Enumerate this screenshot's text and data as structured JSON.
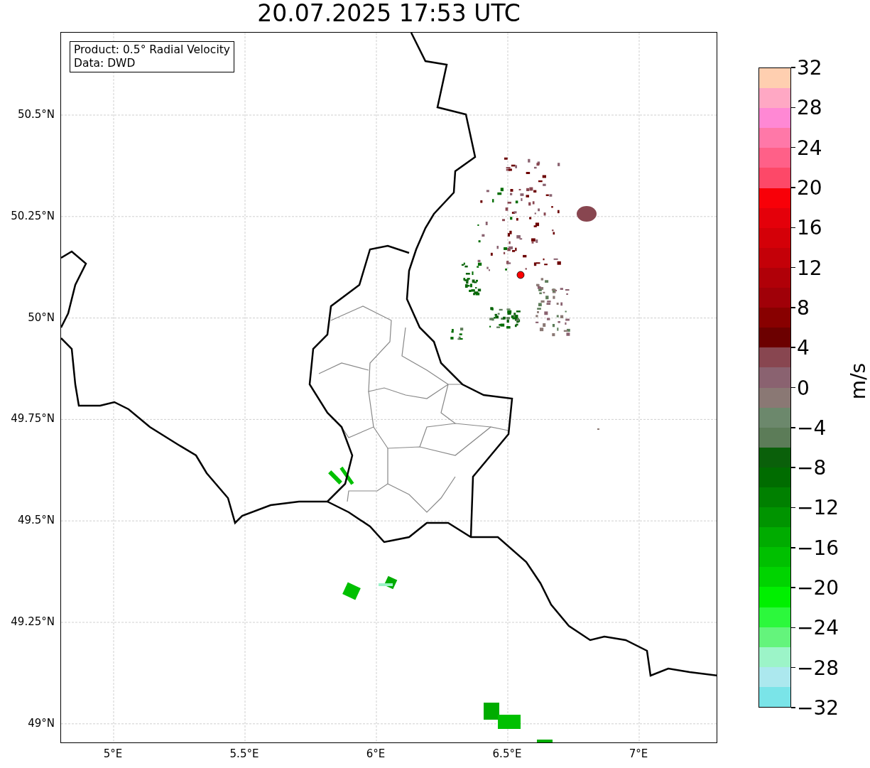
{
  "title": "20.07.2025 17:53 UTC",
  "info_box": {
    "lines": [
      "Product: 0.5° Radial Velocity",
      "Data: DWD"
    ]
  },
  "map": {
    "xticks": [
      "5°E",
      "5.5°E",
      "6°E",
      "6.5°E",
      "7°E"
    ],
    "yticks": [
      "50.5°N",
      "50.25°N",
      "50°N",
      "49.75°N",
      "49.5°N",
      "49.25°N",
      "49°N"
    ]
  },
  "colorbar": {
    "label": "m/s",
    "ticks": [
      "32",
      "28",
      "24",
      "20",
      "16",
      "12",
      "8",
      "4",
      "0",
      "−4",
      "−8",
      "−12",
      "−16",
      "−20",
      "−24",
      "−28",
      "−32"
    ],
    "bands": [
      {
        "color": "#ffcfb0"
      },
      {
        "color": "#ffa8c4"
      },
      {
        "color": "#ff88d4"
      },
      {
        "color": "#ff78a8"
      },
      {
        "color": "#ff6088"
      },
      {
        "color": "#fd4868"
      },
      {
        "color": "#f80008"
      },
      {
        "color": "#e4000a"
      },
      {
        "color": "#d40008"
      },
      {
        "color": "#c40008"
      },
      {
        "color": "#b00008"
      },
      {
        "color": "#a00008"
      },
      {
        "color": "#880000"
      },
      {
        "color": "#6c0000"
      },
      {
        "color": "#884650"
      },
      {
        "color": "#8a6270"
      },
      {
        "color": "#8a7874"
      },
      {
        "color": "#6c886c"
      },
      {
        "color": "#5c7c58"
      },
      {
        "color": "#0a600a"
      },
      {
        "color": "#006c00"
      },
      {
        "color": "#008000"
      },
      {
        "color": "#009400"
      },
      {
        "color": "#00ac00"
      },
      {
        "color": "#00c000"
      },
      {
        "color": "#00d400"
      },
      {
        "color": "#00f000"
      },
      {
        "color": "#2cf83c"
      },
      {
        "color": "#64f47c"
      },
      {
        "color": "#9cf4c8"
      },
      {
        "color": "#ace8ee"
      },
      {
        "color": "#7ae4e8"
      }
    ]
  }
}
